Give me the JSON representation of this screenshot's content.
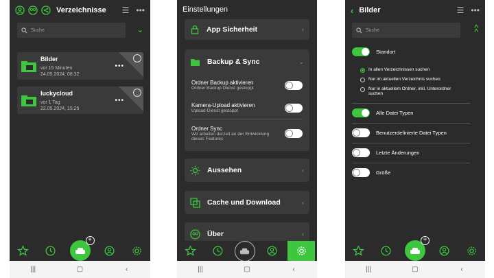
{
  "screen1": {
    "title": "Verzeichnisse",
    "search_placeholder": "Suche",
    "folders": [
      {
        "name": "Bilder",
        "time": "vor 15 Minuten",
        "date": "24.05.2024, 08:32"
      },
      {
        "name": "luckycloud",
        "time": "vor 1 Tag",
        "date": "22.05.2024, 15:25"
      }
    ]
  },
  "screen2": {
    "title": "Einstellungen",
    "app_security": "App Sicherheit",
    "backup_sync": "Backup & Sync",
    "backup_rows": [
      {
        "title": "Ordner Backup aktivieren",
        "sub": "Ordner Backup Dienst gestoppt"
      },
      {
        "title": "Kamera-Upload aktivieren",
        "sub": "Upload-Dienst gestoppt"
      },
      {
        "title": "Ordner Sync",
        "sub": "Wir arbeiten derzeit an der Entwicklung dieses Features"
      }
    ],
    "appearance": "Aussehen",
    "cache": "Cache und Download",
    "about": "Über"
  },
  "screen3": {
    "title": "Bilder",
    "search_placeholder": "Suche",
    "location": "Standort",
    "radio_options": [
      "In allen Verzeichnissen suchen",
      "Nur im aktuellen Verzeichnis suchen",
      "Nur in aktuellem Ordner, inkl. Unterordner suchen"
    ],
    "filters": [
      "Alle Datei Typen",
      "Benutzerdefinierte Datei Typen",
      "Letzte Änderungen",
      "Größe"
    ]
  },
  "colors": {
    "accent": "#3ec63e",
    "bg": "#2b2b2b",
    "card": "#3a3a3a"
  }
}
